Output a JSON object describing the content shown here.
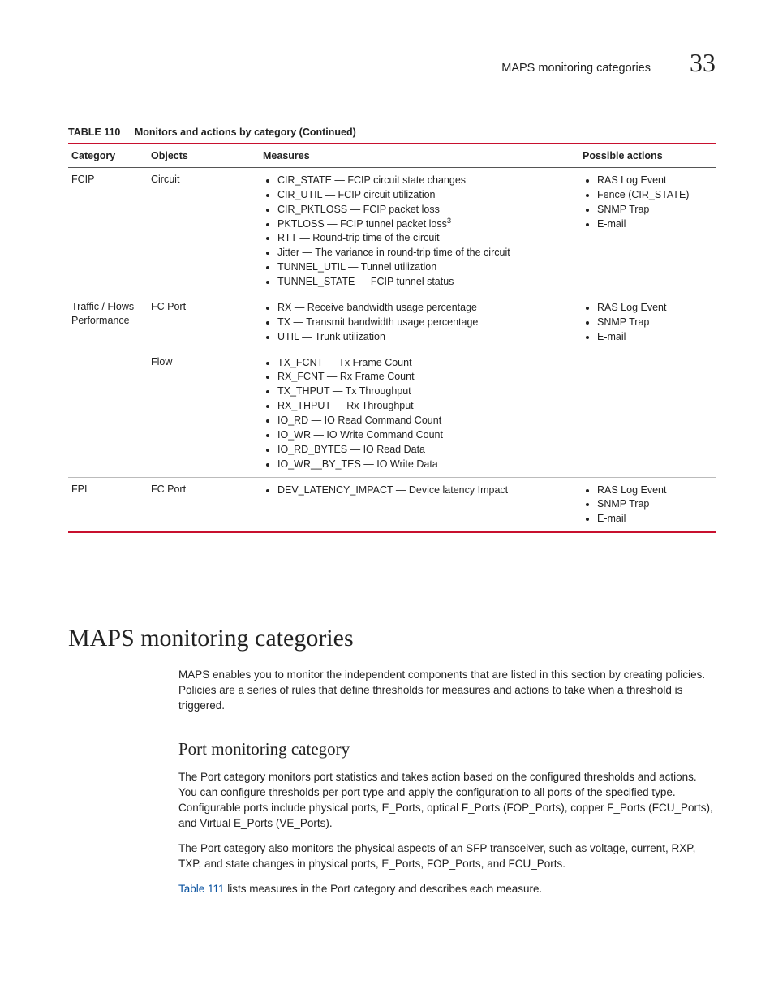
{
  "header": {
    "title": "MAPS monitoring categories",
    "chapter": "33"
  },
  "table": {
    "label": "TABLE 110",
    "caption": "Monitors and actions by category (Continued)",
    "columns": [
      "Category",
      "Objects",
      "Measures",
      "Possible actions"
    ],
    "rows": [
      {
        "category": "FCIP",
        "objects": "Circuit",
        "measures": [
          "CIR_STATE — FCIP circuit state changes",
          "CIR_UTIL — FCIP circuit utilization",
          "CIR_PKTLOSS — FCIP packet loss",
          "PKTLOSS — FCIP tunnel packet loss<SUP>3</SUP>",
          "RTT — Round-trip time of the circuit",
          "Jitter — The variance in round-trip time of the circuit",
          "TUNNEL_UTIL — Tunnel utilization",
          "TUNNEL_STATE — FCIP tunnel status"
        ],
        "actions": [
          "RAS Log Event",
          "Fence (CIR_STATE)",
          "SNMP Trap",
          "E-mail"
        ]
      },
      {
        "category": "Traffic / Flows Performance",
        "objects": "FC Port",
        "measures": [
          "RX — Receive bandwidth usage percentage",
          "TX — Transmit bandwidth usage percentage",
          "UTIL — Trunk utilization"
        ],
        "actions": [
          "RAS Log Event",
          "SNMP Trap",
          "E-mail"
        ]
      },
      {
        "category_cont": true,
        "objects": "Flow",
        "measures": [
          "TX_FCNT — Tx Frame Count",
          "RX_FCNT — Rx Frame Count",
          "TX_THPUT — Tx Throughput",
          "RX_THPUT — Rx Throughput",
          "IO_RD — IO Read Command Count",
          "IO_WR — IO Write Command Count",
          "IO_RD_BYTES — IO Read Data",
          "IO_WR__BY_TES — IO Write Data"
        ],
        "actions_cont": true
      },
      {
        "category": "FPI",
        "objects": "FC Port",
        "measures": [
          "DEV_LATENCY_IMPACT — Device latency Impact"
        ],
        "actions": [
          "RAS Log Event",
          "SNMP Trap",
          "E-mail"
        ]
      }
    ]
  },
  "section": {
    "title": "MAPS monitoring categories",
    "intro": "MAPS enables you to monitor the independent components that are listed in this section by creating policies. Policies are a series of rules that define thresholds for measures and actions to take when a threshold is triggered.",
    "sub": {
      "title": "Port monitoring category",
      "p1": "The Port category monitors port statistics and takes action based on the configured thresholds and actions. You can configure thresholds per port type and apply the configuration to all ports of the specified type. Configurable ports include physical ports, E_Ports, optical F_Ports (FOP_Ports), copper F_Ports (FCU_Ports), and Virtual E_Ports (VE_Ports).",
      "p2": "The Port category also monitors the physical aspects of an SFP transceiver, such as voltage, current, RXP, TXP, and state changes in physical ports, E_Ports, FOP_Ports, and FCU_Ports.",
      "xref": "Table 111",
      "p3_tail": " lists measures in the Port category and describes each measure."
    }
  }
}
